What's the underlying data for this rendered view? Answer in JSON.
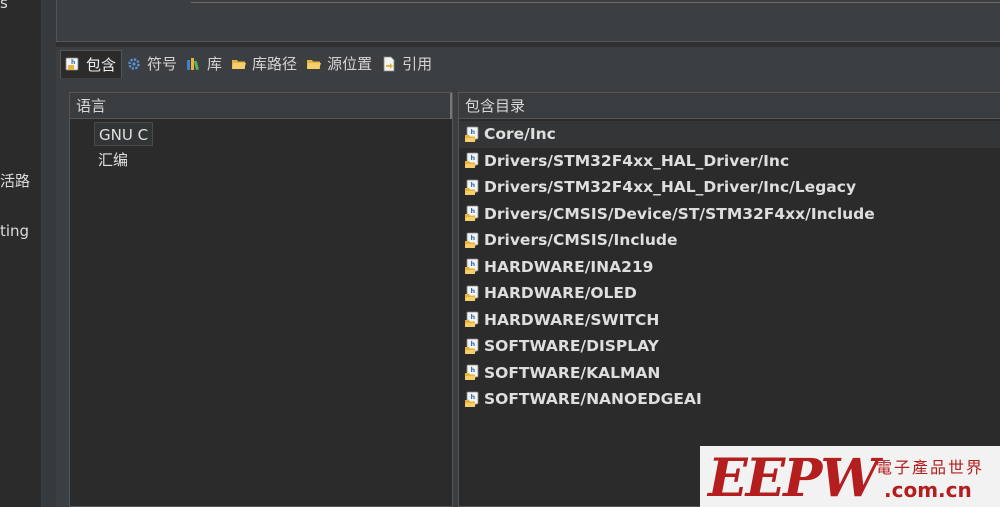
{
  "sidebar": {
    "fragments": [
      "s",
      "活路",
      "ting"
    ]
  },
  "tabs": [
    {
      "label": "包含",
      "icon": "include-icon",
      "active": true
    },
    {
      "label": "符号",
      "icon": "gear-icon",
      "active": false
    },
    {
      "label": "库",
      "icon": "library-icon",
      "active": false
    },
    {
      "label": "库路径",
      "icon": "folder-icon",
      "active": false
    },
    {
      "label": "源位置",
      "icon": "folder-icon",
      "active": false
    },
    {
      "label": "引用",
      "icon": "reference-icon",
      "active": false
    }
  ],
  "languages": {
    "header": "语言",
    "items": [
      "GNU C",
      "汇编"
    ],
    "selected": "GNU C"
  },
  "includes": {
    "header": "包含目录",
    "items": [
      "Core/Inc",
      "Drivers/STM32F4xx_HAL_Driver/Inc",
      "Drivers/STM32F4xx_HAL_Driver/Inc/Legacy",
      "Drivers/CMSIS/Device/ST/STM32F4xx/Include",
      "Drivers/CMSIS/Include",
      "HARDWARE/INA219",
      "HARDWARE/OLED",
      "HARDWARE/SWITCH",
      "SOFTWARE/DISPLAY",
      "SOFTWARE/KALMAN",
      "SOFTWARE/NANOEDGEAI"
    ],
    "selected": "Core/Inc"
  },
  "watermark": {
    "logo": "EEPW",
    "subtitle": "電子產品世界",
    "url": ".com.cn"
  },
  "colors": {
    "background": "#2b2b2b",
    "panel": "#3c3f41",
    "accent_folder": "#e8b33a",
    "watermark_red": "#b41e1e"
  }
}
